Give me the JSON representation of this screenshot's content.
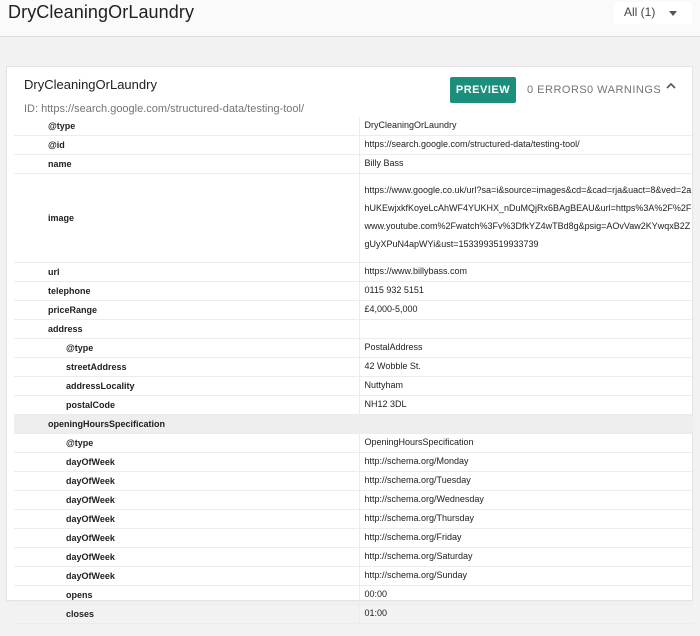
{
  "topbar": {
    "title": "DryCleaningOrLaundry",
    "filter_label": "All (1)"
  },
  "card": {
    "title": "DryCleaningOrLaundry",
    "id_line": "ID: https://search.google.com/structured-data/testing-tool/",
    "preview_label": "PREVIEW",
    "errors_label": "0 ERRORS",
    "warnings_label": "0 WARNINGS",
    "collapse_icon": "chevron-up-icon"
  },
  "properties": [
    {
      "key": "@type",
      "value": "DryCleaningOrLaundry",
      "level": 0
    },
    {
      "key": "@id",
      "value": "https://search.google.com/structured-data/testing-tool/",
      "level": 0
    },
    {
      "key": "name",
      "value": "Billy Bass",
      "level": 0
    },
    {
      "key": "image",
      "value": "https://www.google.co.uk/url?sa=i&source=images&cd=&cad=rja&uact=8&ved=2ahUKEwjxkfKoyeLcAhWF4YUKHX_nDuMQjRx6BAgBEAU&url=https%3A%2F%2Fwww.youtube.com%2Fwatch%3Fv%3DfkYZ4wTBd8g&psig=AOvVaw2KYwqxB2ZgUyXPuN4apWYi&ust=1533993519933739",
      "level": 0,
      "tall": true
    },
    {
      "key": "url",
      "value": "https://www.billybass.com",
      "level": 0
    },
    {
      "key": "telephone",
      "value": "0115 932 5151",
      "level": 0
    },
    {
      "key": "priceRange",
      "value": "£4,000-5,000",
      "level": 0
    },
    {
      "key": "address",
      "value": "",
      "level": 0
    },
    {
      "key": "@type",
      "value": "PostalAddress",
      "level": 1
    },
    {
      "key": "streetAddress",
      "value": "42 Wobble St.",
      "level": 1
    },
    {
      "key": "addressLocality",
      "value": "Nuttyham",
      "level": 1
    },
    {
      "key": "postalCode",
      "value": "NH12 3DL",
      "level": 1
    },
    {
      "key": "openingHoursSpecification",
      "value": "",
      "level": 0,
      "highlight": true
    },
    {
      "key": "@type",
      "value": "OpeningHoursSpecification",
      "level": 1
    },
    {
      "key": "dayOfWeek",
      "value": "http://schema.org/Monday",
      "level": 1
    },
    {
      "key": "dayOfWeek",
      "value": "http://schema.org/Tuesday",
      "level": 1
    },
    {
      "key": "dayOfWeek",
      "value": "http://schema.org/Wednesday",
      "level": 1
    },
    {
      "key": "dayOfWeek",
      "value": "http://schema.org/Thursday",
      "level": 1
    },
    {
      "key": "dayOfWeek",
      "value": "http://schema.org/Friday",
      "level": 1
    },
    {
      "key": "dayOfWeek",
      "value": "http://schema.org/Saturday",
      "level": 1
    },
    {
      "key": "dayOfWeek",
      "value": "http://schema.org/Sunday",
      "level": 1
    },
    {
      "key": "opens",
      "value": "00:00",
      "level": 1
    },
    {
      "key": "closes",
      "value": "01:00",
      "level": 1
    }
  ]
}
